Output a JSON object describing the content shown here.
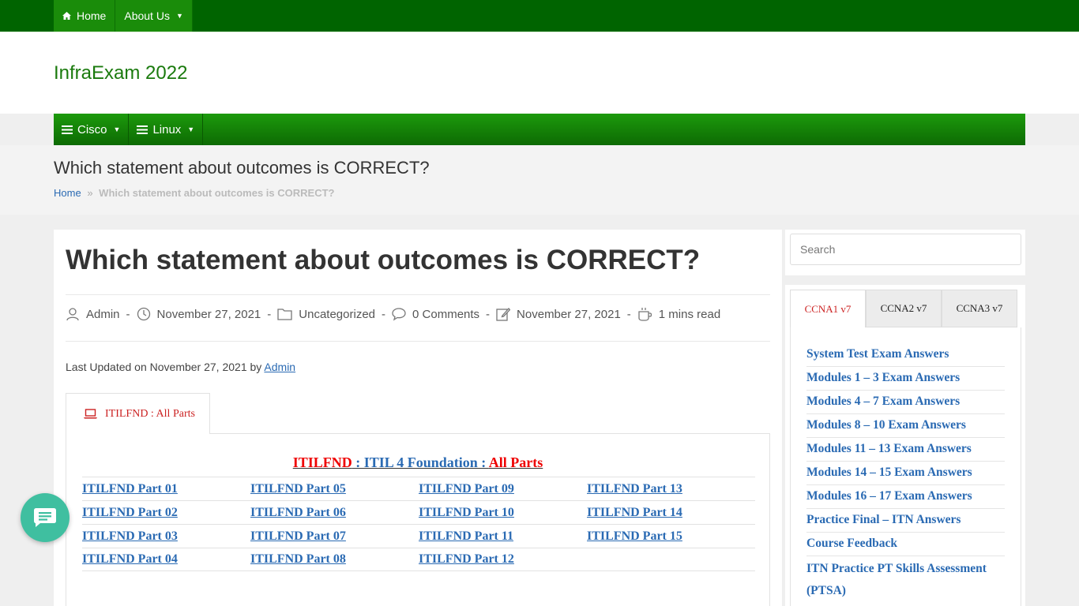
{
  "topnav": {
    "home_label": "Home",
    "about_label": "About Us"
  },
  "site": {
    "title": "InfraExam 2022"
  },
  "mainnav": {
    "cisco_label": "Cisco",
    "linux_label": "Linux"
  },
  "pageheader": {
    "title": "Which statement about outcomes is CORRECT?",
    "breadcrumb_home": "Home",
    "breadcrumb_sep": "»",
    "breadcrumb_current": "Which statement about outcomes is CORRECT?"
  },
  "article": {
    "title": "Which statement about outcomes is CORRECT?",
    "meta": {
      "author": "Admin",
      "published": "November 27, 2021",
      "category": "Uncategorized",
      "comments": "0 Comments",
      "modified": "November 27, 2021",
      "read_time": "1 mins read"
    },
    "last_updated_prefix": "Last Updated on November 27, 2021 by",
    "last_updated_author": "Admin",
    "tab_label": "ITILFND : All Parts",
    "parts_title_a": "ITILFND",
    "parts_title_b": " : ITIL 4 Foundation : ",
    "parts_title_c": "All Parts",
    "parts": [
      [
        "ITILFND Part 01",
        "ITILFND Part 05",
        "ITILFND Part 09",
        "ITILFND Part 13"
      ],
      [
        "ITILFND Part 02",
        "ITILFND Part 06",
        "ITILFND Part 10",
        "ITILFND Part 14"
      ],
      [
        "ITILFND Part 03",
        "ITILFND Part 07",
        "ITILFND Part 11",
        "ITILFND Part 15"
      ],
      [
        "ITILFND Part 04",
        "ITILFND Part 08",
        "ITILFND Part 12",
        ""
      ]
    ]
  },
  "sidebar": {
    "search_placeholder": "Search",
    "tabs": [
      "CCNA1 v7",
      "CCNA2 v7",
      "CCNA3 v7"
    ],
    "links": [
      "System Test Exam Answers",
      "Modules 1 – 3 Exam Answers",
      "Modules 4 – 7 Exam Answers",
      "Modules 8 – 10 Exam Answers",
      "Modules 11 – 13 Exam Answers",
      "Modules 14 – 15 Exam Answers",
      "Modules 16 – 17 Exam Answers",
      "Practice Final – ITN Answers",
      "Course Feedback",
      "ITN Practice PT Skills Assessment (PTSA)"
    ]
  },
  "colors": {
    "topbar": "#006400",
    "nav_green": "#1a8c0a",
    "link_blue": "#2a6ab3",
    "accent_red": "#e00000",
    "chat_teal": "#3fbfa0"
  }
}
